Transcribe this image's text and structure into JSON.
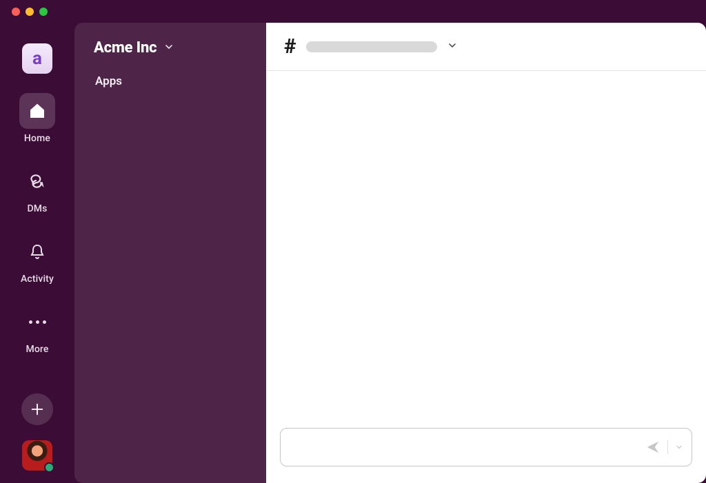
{
  "window": {
    "platform_buttons": [
      "close",
      "minimize",
      "maximize"
    ]
  },
  "workspace": {
    "initial": "a",
    "name": "Acme Inc"
  },
  "rail": {
    "items": [
      {
        "id": "home",
        "label": "Home",
        "active": true
      },
      {
        "id": "dms",
        "label": "DMs",
        "active": false
      },
      {
        "id": "activity",
        "label": "Activity",
        "active": false
      },
      {
        "id": "more",
        "label": "More",
        "active": false
      }
    ],
    "plus_label": "Create new"
  },
  "sidebar": {
    "sections": [
      {
        "id": "apps",
        "label": "Apps"
      }
    ]
  },
  "channel": {
    "prefix": "#",
    "name_placeholder": true,
    "dropdown": true
  },
  "composer": {
    "placeholder": "",
    "value": "",
    "send_enabled": false
  },
  "user": {
    "presence": "active"
  },
  "colors": {
    "app_bg": "#3b0c36",
    "sidebar_bg": "#4e2449",
    "main_bg": "#ffffff",
    "presence_active": "#2bac76"
  }
}
